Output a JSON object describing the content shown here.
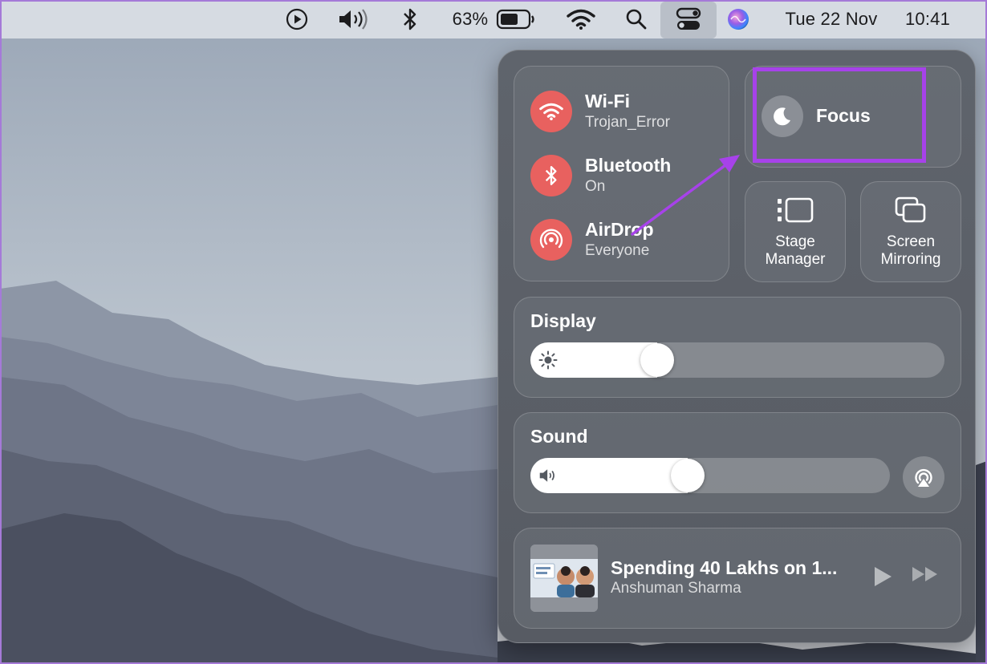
{
  "menubar": {
    "battery_percent": "63%",
    "date": "Tue 22 Nov",
    "time": "10:41",
    "icons": [
      "play-icon",
      "volume-icon",
      "bluetooth-icon",
      "battery-icon",
      "wifi-icon",
      "search-icon",
      "control-center-icon",
      "siri-icon"
    ]
  },
  "control_center": {
    "wifi": {
      "title": "Wi-Fi",
      "subtitle": "Trojan_Error",
      "icon": "wifi-icon"
    },
    "bluetooth": {
      "title": "Bluetooth",
      "subtitle": "On",
      "icon": "bluetooth-icon"
    },
    "airdrop": {
      "title": "AirDrop",
      "subtitle": "Everyone",
      "icon": "airdrop-icon"
    },
    "focus": {
      "label": "Focus",
      "icon": "moon-icon"
    },
    "stage_manager": {
      "line1": "Stage",
      "line2": "Manager",
      "icon": "stage-manager-icon"
    },
    "screen_mirroring": {
      "line1": "Screen",
      "line2": "Mirroring",
      "icon": "screen-mirroring-icon"
    },
    "display": {
      "title": "Display",
      "brightness_level": 0.29,
      "icon": "sun-icon"
    },
    "sound": {
      "title": "Sound",
      "volume_level": 0.43,
      "icon": "speaker-icon"
    },
    "now_playing": {
      "title": "Spending 40 Lakhs on 1...",
      "artist": "Anshuman Sharma"
    }
  },
  "colors": {
    "accent_active": "#e8615f",
    "annotation": "#a742ea"
  }
}
